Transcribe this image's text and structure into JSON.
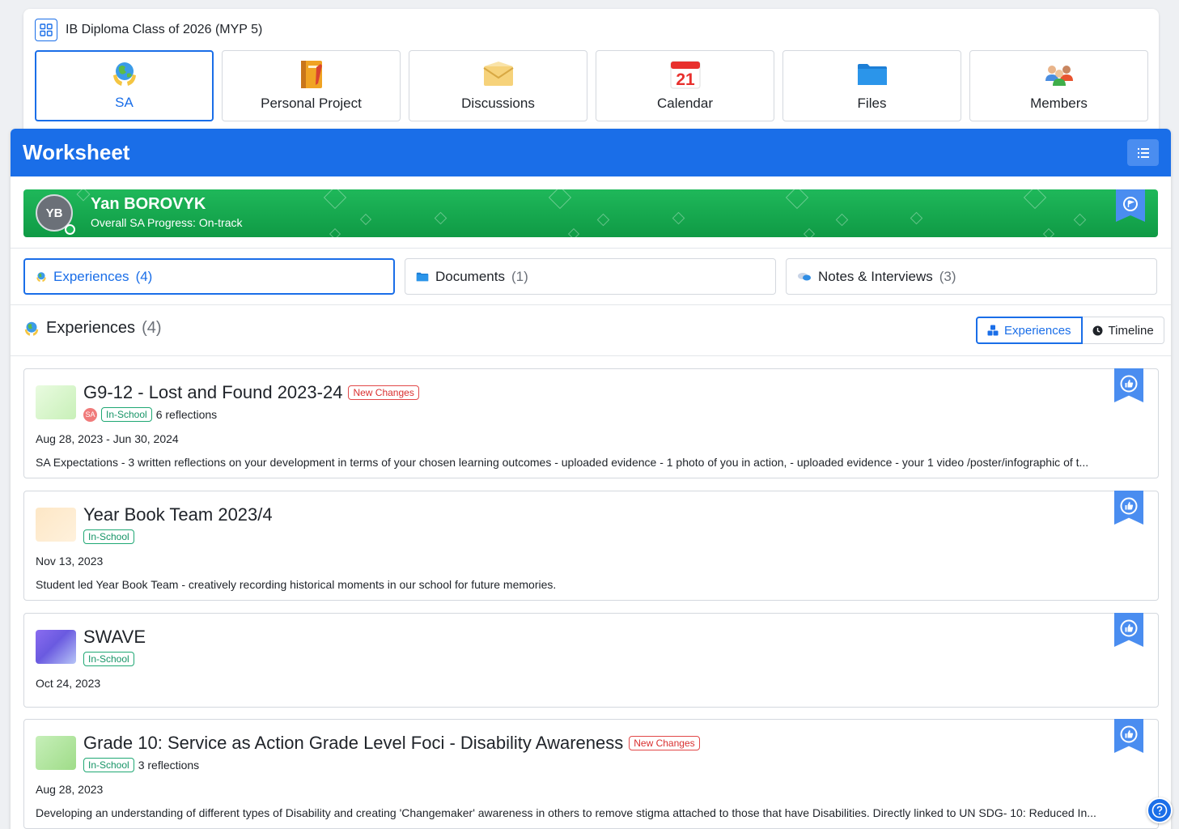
{
  "group": {
    "title": "IB Diploma Class of 2026 (MYP 5)"
  },
  "app_tabs": [
    {
      "label": "SA",
      "icon": "globe-hands-icon"
    },
    {
      "label": "Personal Project",
      "icon": "notebook-icon"
    },
    {
      "label": "Discussions",
      "icon": "envelope-icon"
    },
    {
      "label": "Calendar",
      "icon": "calendar-icon",
      "day": "21"
    },
    {
      "label": "Files",
      "icon": "folder-icon"
    },
    {
      "label": "Members",
      "icon": "people-icon"
    }
  ],
  "worksheet": {
    "title": "Worksheet"
  },
  "student": {
    "initials": "YB",
    "name": "Yan BOROVYK",
    "progress": "Overall SA Progress: On-track"
  },
  "sub_tabs": [
    {
      "label": "Experiences",
      "count": "(4)"
    },
    {
      "label": "Documents",
      "count": "(1)"
    },
    {
      "label": "Notes & Interviews",
      "count": "(3)"
    }
  ],
  "section": {
    "title": "Experiences",
    "count": "(4)",
    "view_experiences": "Experiences",
    "view_timeline": "Timeline"
  },
  "experiences": [
    {
      "title": "G9-12 - Lost and Found 2023-24",
      "badge": "New Changes",
      "sa_tag": "SA",
      "location": "In-School",
      "reflections": "6 reflections",
      "date": "Aug 28, 2023 - Jun 30, 2024",
      "description": "SA Expectations - 3 written reflections on your development in terms of your chosen learning outcomes - uploaded evidence - 1 photo of you in action, - uploaded evidence - your 1 video /poster/infographic of t..."
    },
    {
      "title": "Year Book Team 2023/4",
      "location": "In-School",
      "date": "Nov 13, 2023",
      "description": "Student led Year Book Team - creatively recording historical moments in our school for future memories."
    },
    {
      "title": "SWAVE",
      "location": "In-School",
      "date": "Oct 24, 2023"
    },
    {
      "title": "Grade 10: Service as Action Grade Level Foci - Disability Awareness",
      "badge": "New Changes",
      "location": "In-School",
      "reflections": "3 reflections",
      "date": "Aug 28, 2023",
      "description": "Developing an understanding of different types of Disability and creating 'Changemaker' awareness in others to remove stigma attached to those that have Disabilities. Directly linked to UN SDG- 10: Reduced In..."
    }
  ],
  "colors": {
    "primary": "#1a6ee8",
    "banner_green": "#1fb85a",
    "new_changes_red": "#e24848",
    "in_school_green": "#1fa874"
  }
}
